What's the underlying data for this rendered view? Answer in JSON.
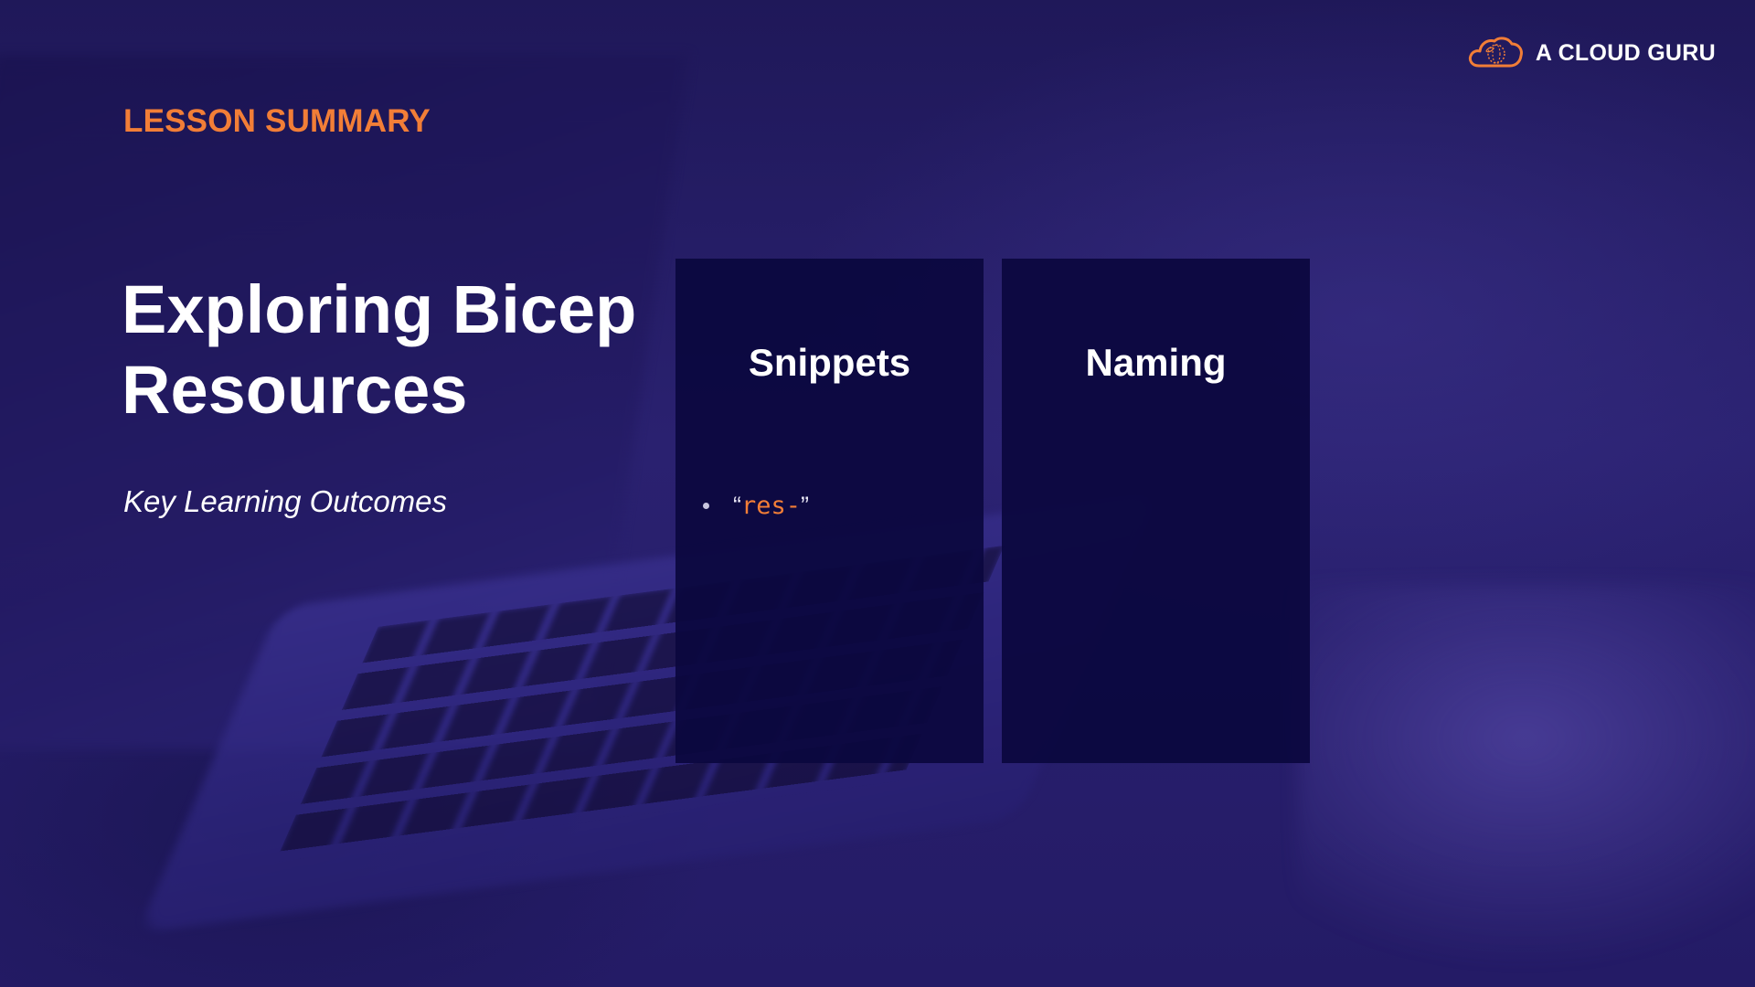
{
  "brand": {
    "name": "A CLOUD GURU",
    "icon": "cloud-logo-icon",
    "accent_color": "#f27e37"
  },
  "slide": {
    "section_label": "LESSON SUMMARY",
    "title": "Exploring Bicep\nResources",
    "subtitle": "Key Learning Outcomes"
  },
  "cards": [
    {
      "heading": "Snippets",
      "items": [
        {
          "open_quote": "“",
          "code": "res-",
          "close_quote": "”"
        }
      ]
    },
    {
      "heading": "Naming",
      "items": []
    }
  ]
}
